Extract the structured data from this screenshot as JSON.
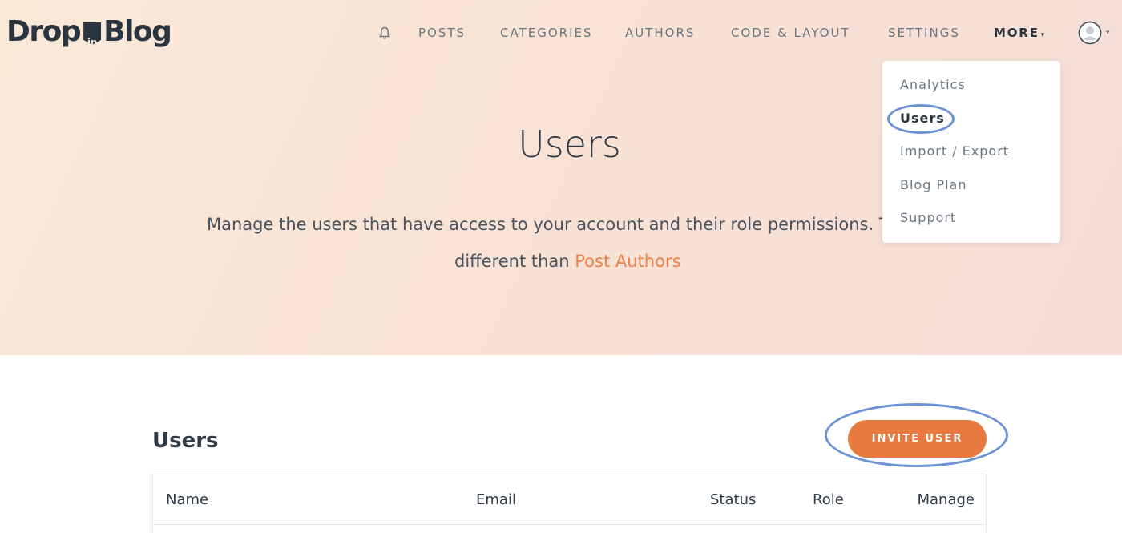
{
  "brand": {
    "name_left": "Drop",
    "name_badge": "in",
    "name_right": "Blog"
  },
  "nav": {
    "items": [
      "POSTS",
      "CATEGORIES",
      "AUTHORS",
      "CODE & LAYOUT",
      "SETTINGS"
    ],
    "more_label": "MORE",
    "more_caret": "▾",
    "notification_icon": "bell-icon",
    "avatar_icon": "user-avatar-icon",
    "avatar_caret": "▾"
  },
  "dropdown": {
    "items": [
      "Analytics",
      "Users",
      "Import / Export",
      "Blog Plan",
      "Support"
    ],
    "active": "Users"
  },
  "hero": {
    "title": "Users",
    "description_line1": "Manage the users that have access to your account and their role permissions. T",
    "description_line2_prefix": "different than ",
    "description_link": "Post Authors"
  },
  "users_section": {
    "title": "Users",
    "invite_button": "INVITE USER",
    "table_headers": [
      "Name",
      "Email",
      "Status",
      "Role",
      "Manage"
    ]
  },
  "colors": {
    "accent": "#e97a3f",
    "link": "#ef7f45",
    "highlight_ring": "#6d93d6",
    "text_dark": "#2b3540"
  }
}
